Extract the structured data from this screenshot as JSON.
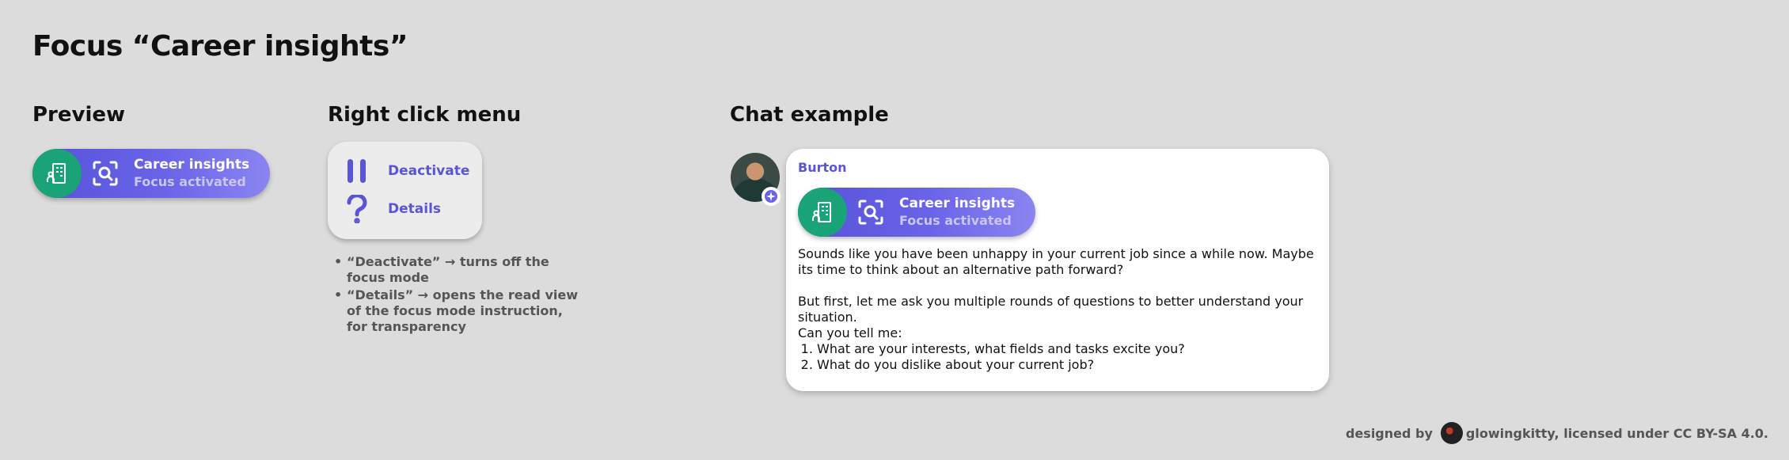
{
  "page": {
    "title": "Focus “Career insights”"
  },
  "sections": {
    "preview": "Preview",
    "right_click_menu": "Right click menu",
    "chat_example": "Chat example"
  },
  "focus_pill": {
    "title": "Career insights",
    "status": "Focus activated",
    "lead_icon": "building-person-icon",
    "scan_icon": "scan-search-icon",
    "colors": {
      "lead": "#1aa377",
      "gradient_start": "#5552d8",
      "gradient_end": "#8a85f0"
    }
  },
  "context_menu": {
    "items": [
      {
        "label": "Deactivate",
        "icon": "pause-icon"
      },
      {
        "label": "Details",
        "icon": "question-icon"
      }
    ],
    "notes": [
      "“Deactivate” → turns off the focus mode",
      "“Details” → opens the read view of the focus mode instruction, for transparency"
    ]
  },
  "chat": {
    "sender": "Burton",
    "paragraph1": "Sounds like you have been unhappy in your current job since a while now. Maybe its time to think about an alternative path forward?",
    "paragraph2": "But first, let me ask you multiple rounds of questions to better understand your situation.",
    "paragraph3": "Can you tell me:",
    "questions": [
      "What are your interests, what fields and tasks excite you?",
      "What do you dislike about your current job?"
    ]
  },
  "footer": {
    "prefix": "designed by",
    "credit": "glowingkitty, licensed under CC BY-SA 4.0."
  },
  "accent_color": "#5a55d6"
}
